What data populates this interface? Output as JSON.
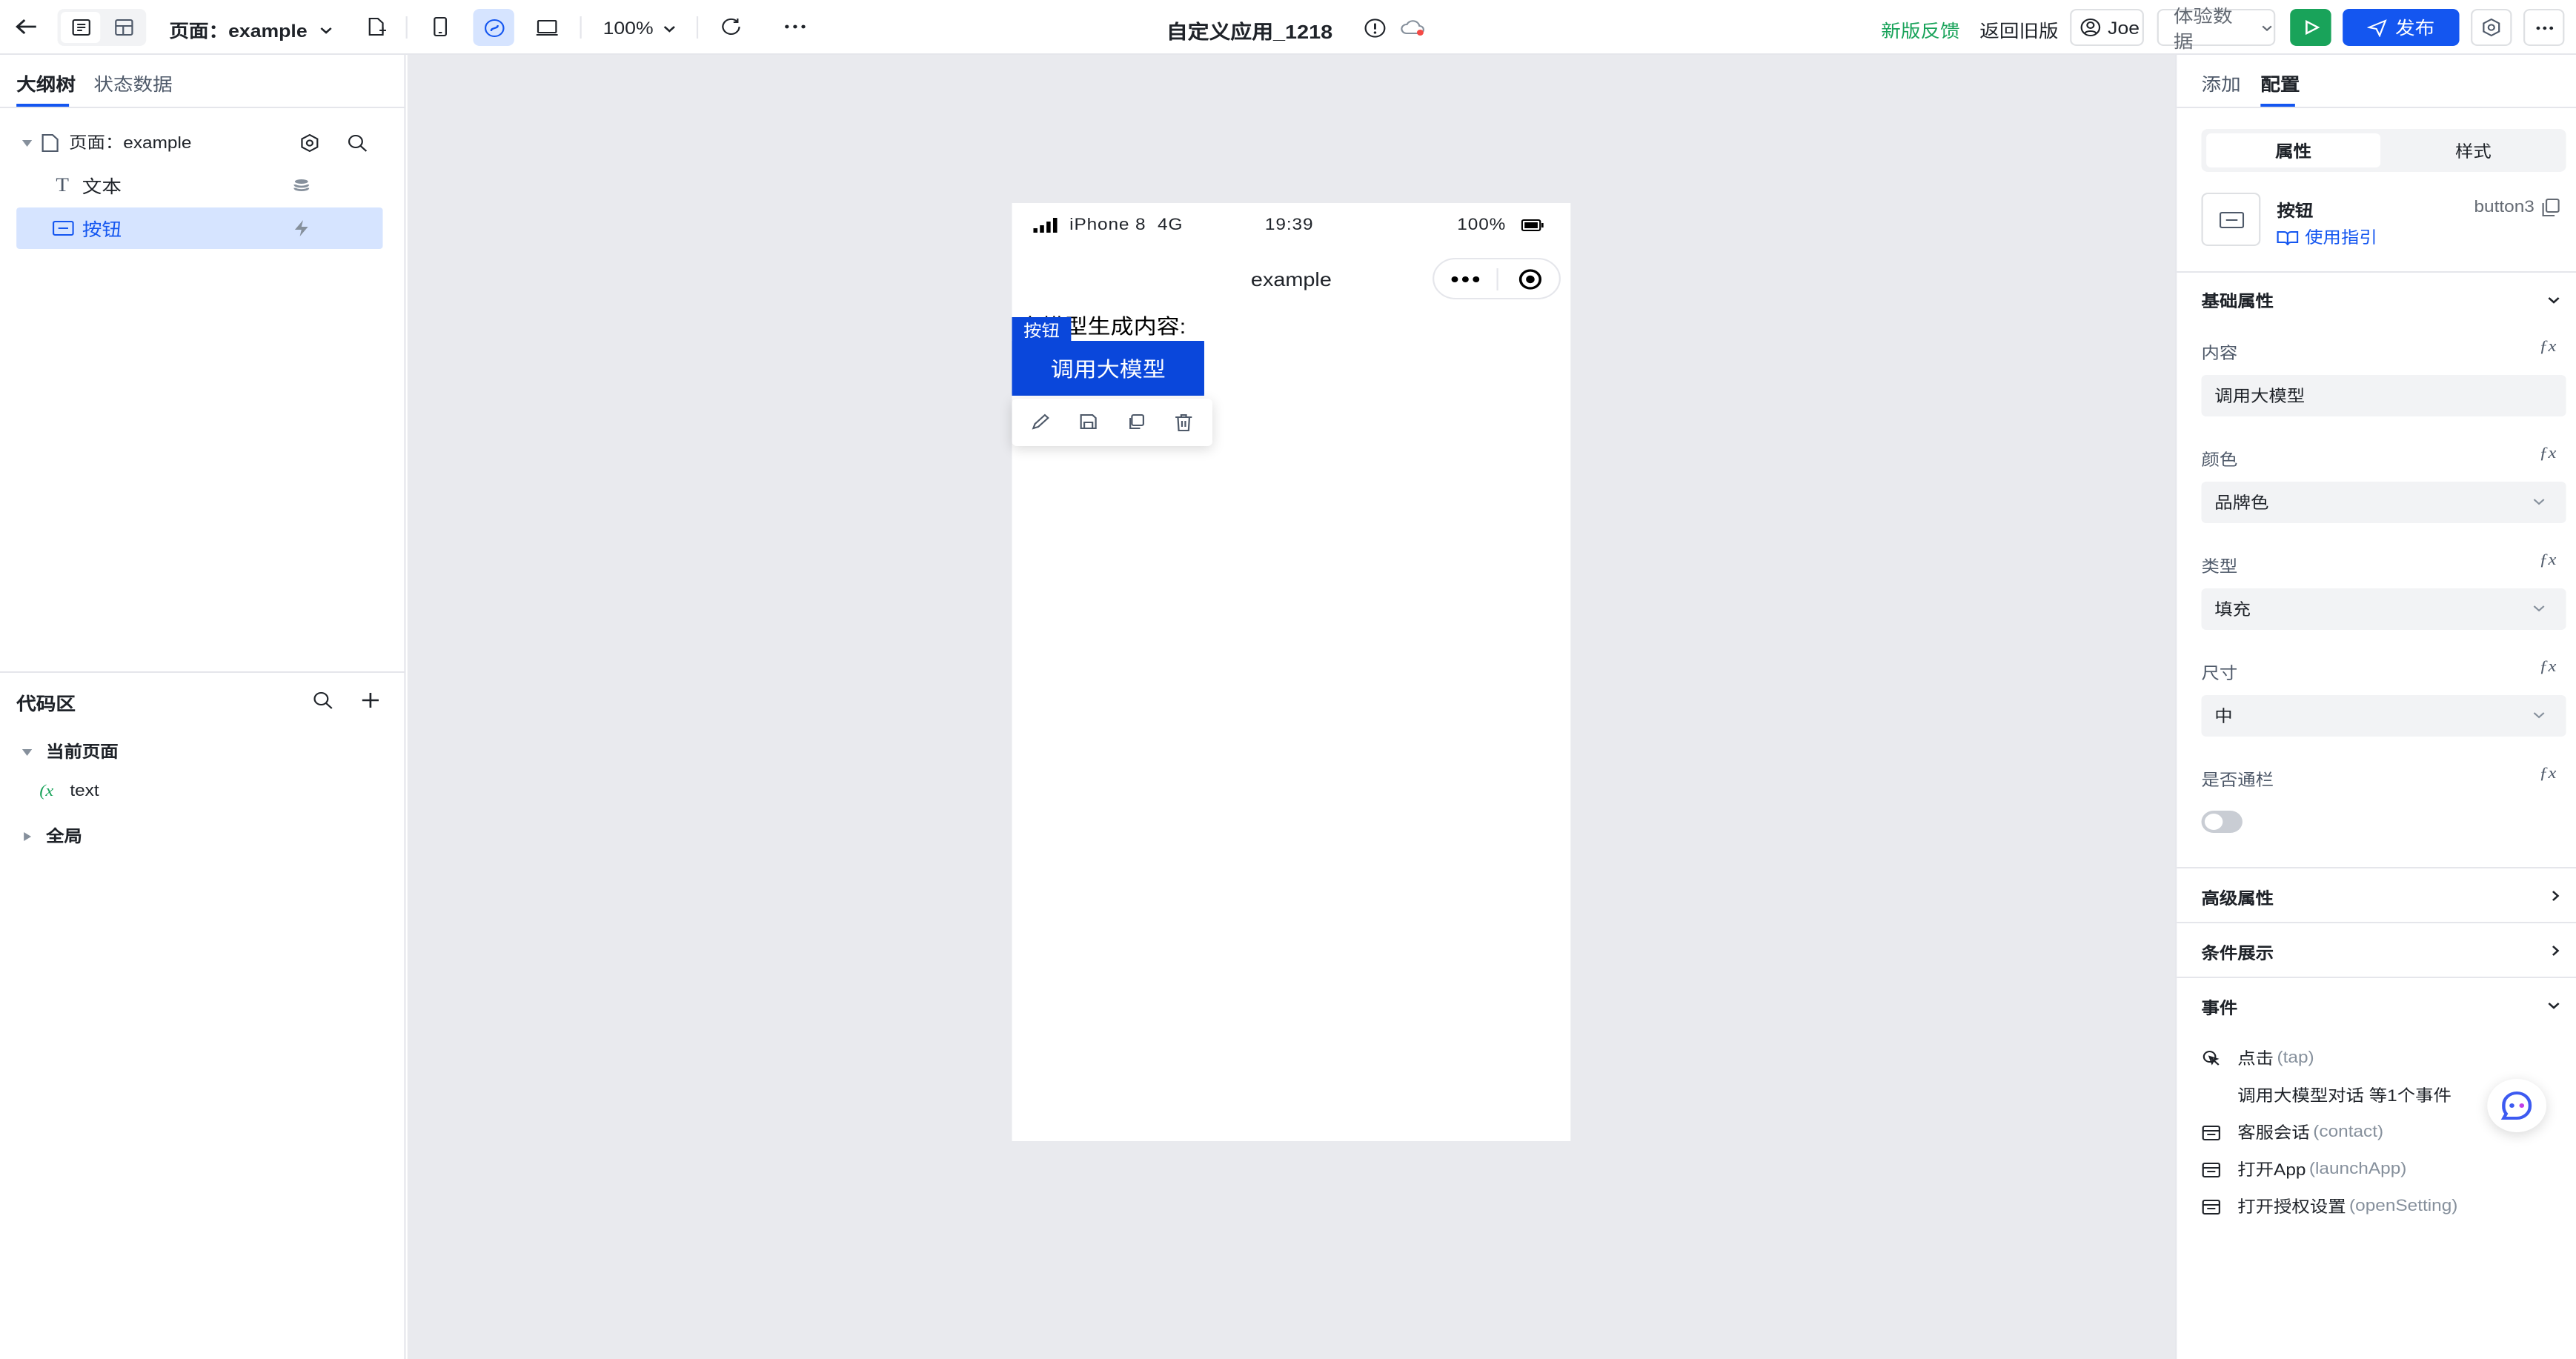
{
  "topbar": {
    "page_label": "页面：example",
    "zoom": "100%",
    "app_title": "自定义应用_1218",
    "feedback": "新版反馈",
    "return_old": "返回旧版",
    "user": "Joe",
    "experience_data": "体验数据",
    "publish": "发布"
  },
  "left": {
    "tabs": [
      {
        "label": "大纲树"
      },
      {
        "label": "状态数据"
      }
    ],
    "tree": [
      {
        "label": "页面：example"
      },
      {
        "label": "文本"
      },
      {
        "label": "按钮"
      }
    ],
    "code_title": "代码区",
    "code_items": [
      {
        "label": "当前页面"
      },
      {
        "label": "text"
      },
      {
        "label": "全局"
      }
    ]
  },
  "phone": {
    "carrier": "iPhone 8",
    "network": "4G",
    "time": "19:39",
    "battery": "100%",
    "nav_title": "example",
    "text_content": "大模型生成内容:",
    "button_tag": "按钮",
    "button_label": "调用大模型"
  },
  "right": {
    "tabs": [
      {
        "label": "添加"
      },
      {
        "label": "配置"
      }
    ],
    "seg": [
      {
        "label": "属性"
      },
      {
        "label": "样式"
      }
    ],
    "component_name": "按钮",
    "component_id": "button3",
    "guide_link": "使用指引",
    "basic_title": "基础属性",
    "fields": [
      {
        "label": "内容",
        "value": "调用大模型"
      },
      {
        "label": "颜色",
        "value": "品牌色"
      },
      {
        "label": "类型",
        "value": "填充"
      },
      {
        "label": "尺寸",
        "value": "中"
      }
    ],
    "fullwidth_label": "是否通栏",
    "fullwidth_on": false,
    "advanced_title": "高级属性",
    "condition_title": "条件展示",
    "events_title": "事件",
    "events": [
      {
        "label": "点击",
        "code": "(tap)"
      },
      {
        "label": "调用大模型对话 等1个事件",
        "code": ""
      },
      {
        "label": "客服会话",
        "code": "(contact)"
      },
      {
        "label": "打开App",
        "code": "(launchApp)"
      },
      {
        "label": "打开授权设置",
        "code": "(openSetting)"
      }
    ]
  },
  "colors": {
    "brand": "#1456f0",
    "selected_bg": "#d6e4ff",
    "run_green": "#19a35a",
    "feedback_green": "#19a35a",
    "canvas_bg": "#e9eaee",
    "button_blue": "#0a47db"
  }
}
